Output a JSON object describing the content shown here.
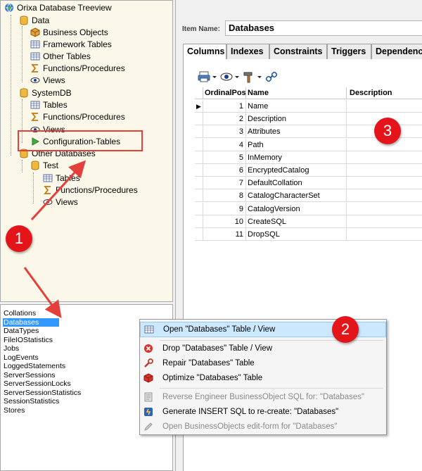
{
  "tree": {
    "root": "Orixa Database Treeview",
    "nodes": [
      {
        "label": "Data",
        "icon": "database-icon"
      },
      {
        "label": "Business Objects",
        "icon": "cube-icon"
      },
      {
        "label": "Framework Tables",
        "icon": "table-icon"
      },
      {
        "label": "Other Tables",
        "icon": "table-icon"
      },
      {
        "label": "Functions/Procedures",
        "icon": "sigma-icon"
      },
      {
        "label": "Views",
        "icon": "eye-icon"
      },
      {
        "label": "SystemDB",
        "icon": "database-icon"
      },
      {
        "label": "Tables",
        "icon": "table-icon"
      },
      {
        "label": "Functions/Procedures",
        "icon": "sigma-icon"
      },
      {
        "label": "Views",
        "icon": "eye-icon"
      },
      {
        "label": "Configuration-Tables",
        "icon": "play-icon"
      },
      {
        "label": "Other Databases",
        "icon": "database-icon"
      },
      {
        "label": "Test",
        "icon": "database-icon"
      },
      {
        "label": "Tables",
        "icon": "table-icon"
      },
      {
        "label": "Functions/Procedures",
        "icon": "sigma-icon"
      },
      {
        "label": "Views",
        "icon": "eye-icon"
      }
    ]
  },
  "list": {
    "items": [
      "Collations",
      "Databases",
      "DataTypes",
      "FileIOStatistics",
      "Jobs",
      "LogEvents",
      "LoggedStatements",
      "ServerSessions",
      "ServerSessionLocks",
      "ServerSessionStatistics",
      "SessionStatistics",
      "Stores"
    ],
    "selected": "Databases"
  },
  "detail": {
    "item_name_label": "Item Name:",
    "item_name_value": "Databases",
    "tabs": [
      "Columns",
      "Indexes",
      "Constraints",
      "Triggers",
      "Dependencies"
    ],
    "active_tab": "Columns",
    "grid": {
      "headers": [
        "OrdinalPos",
        "Name",
        "Description"
      ],
      "rows": [
        {
          "pos": "1",
          "name": "Name"
        },
        {
          "pos": "2",
          "name": "Description"
        },
        {
          "pos": "3",
          "name": "Attributes"
        },
        {
          "pos": "4",
          "name": "Path"
        },
        {
          "pos": "5",
          "name": "InMemory"
        },
        {
          "pos": "6",
          "name": "EncryptedCatalog"
        },
        {
          "pos": "7",
          "name": "DefaultCollation"
        },
        {
          "pos": "8",
          "name": "CatalogCharacterSet"
        },
        {
          "pos": "9",
          "name": "CatalogVersion"
        },
        {
          "pos": "10",
          "name": "CreateSQL"
        },
        {
          "pos": "11",
          "name": "DropSQL"
        }
      ]
    }
  },
  "context_menu": {
    "items": [
      {
        "label": "Open \"Databases\" Table / View",
        "icon": "table-icon",
        "state": "highlighted"
      },
      {
        "label": "Drop \"Databases\" Table / View",
        "icon": "delete-icon",
        "state": "enabled"
      },
      {
        "label": "Repair \"Databases\" Table",
        "icon": "wrench-icon",
        "state": "enabled"
      },
      {
        "label": "Optimize \"Databases\" Table",
        "icon": "optimize-icon",
        "state": "enabled"
      },
      {
        "label": "Reverse Engineer BusinessObject SQL for: \"Databases\"",
        "icon": "reverse-engineer-icon",
        "state": "disabled"
      },
      {
        "label": "Generate INSERT SQL to re-create: \"Databases\"",
        "icon": "generate-sql-icon",
        "state": "enabled"
      },
      {
        "label": "Open BusinessObjects edit-form for \"Databases\"",
        "icon": "edit-form-icon",
        "state": "disabled"
      }
    ]
  },
  "annotations": {
    "badges": [
      "1",
      "2",
      "3"
    ],
    "color": "#e4141b"
  }
}
